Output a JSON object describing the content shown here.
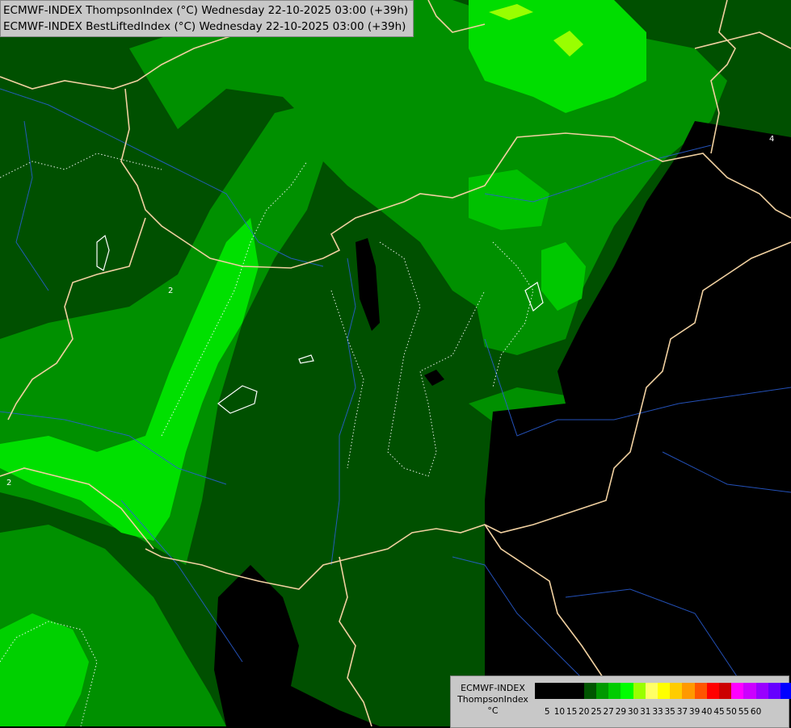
{
  "title": {
    "line1": "ECMWF-INDEX ThompsonIndex (°C) Wednesday 22-10-2025 03:00 (+39h)",
    "line2": "ECMWF-INDEX BestLiftedIndex (°C) Wednesday 22-10-2025 03:00 (+39h)"
  },
  "contour_labels": [
    "2",
    "2",
    "4"
  ],
  "legend": {
    "model": "ECMWF-INDEX",
    "parameter": "ThompsonIndex",
    "unit": "°C",
    "ticks": [
      "5",
      "10",
      "15",
      "20",
      "25",
      "27",
      "29",
      "30",
      "31",
      "33",
      "35",
      "37",
      "39",
      "40",
      "45",
      "50",
      "55",
      "60"
    ],
    "colors": [
      "#000000",
      "#000000",
      "#000000",
      "#000000",
      "#005500",
      "#009900",
      "#00cc00",
      "#00ff00",
      "#99ff00",
      "#ffff66",
      "#ffff00",
      "#ffcc00",
      "#ff9900",
      "#ff5500",
      "#ff0000",
      "#cc0000",
      "#ff00ff",
      "#cc00ff",
      "#9900ff",
      "#6600ff",
      "#0000ff"
    ]
  }
}
